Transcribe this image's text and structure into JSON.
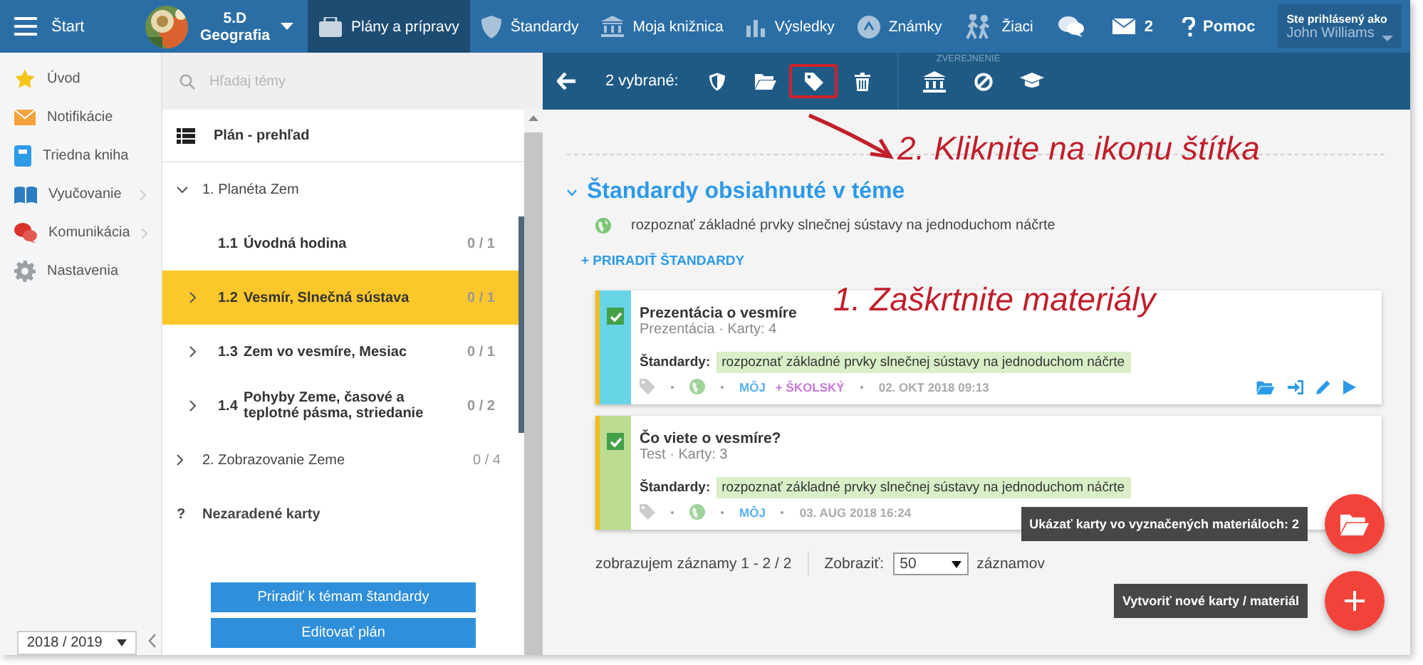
{
  "nav": {
    "menu_label": "Štart",
    "class": {
      "name": "5.D",
      "subject": "Geografia"
    },
    "tabs": [
      {
        "label": "Plány a prípravy",
        "selected": true
      },
      {
        "label": "Štandardy",
        "selected": false
      },
      {
        "label": "Moja knižnica",
        "selected": false
      },
      {
        "label": "Výsledky",
        "selected": false
      },
      {
        "label": "Známky",
        "selected": false
      },
      {
        "label": "Žiaci",
        "selected": false
      }
    ],
    "mail_count": "2",
    "help": "Pomoc",
    "user": {
      "caption": "Ste prihlásený ako",
      "name": "John Williams"
    }
  },
  "sidebar": {
    "items": [
      {
        "label": "Úvod",
        "has_submenu": false
      },
      {
        "label": "Notifikácie",
        "has_submenu": false
      },
      {
        "label": "Triedna kniha",
        "has_submenu": false
      },
      {
        "label": "Vyučovanie",
        "has_submenu": true
      },
      {
        "label": "Komunikácia",
        "has_submenu": true
      },
      {
        "label": "Nastavenia",
        "has_submenu": false
      }
    ],
    "year": "2018 / 2019"
  },
  "topics": {
    "search_placeholder": "Hľadaj témy",
    "overview": "Plán - prehľad",
    "tree": [
      {
        "label": "1. Planéta Zem",
        "expanded": true,
        "selected": false,
        "children": [
          {
            "number": "1.1",
            "title": "Úvodná hodina",
            "count": "0 / 1",
            "has_children": false,
            "selected": false
          },
          {
            "number": "1.2",
            "title": "Vesmír, Slnečná sústava",
            "count": "0 / 1",
            "has_children": true,
            "selected": true
          },
          {
            "number": "1.3",
            "title": "Zem vo vesmíre, Mesiac",
            "count": "0 / 1",
            "has_children": true,
            "selected": false
          },
          {
            "number": "1.4",
            "title": "Pohyby Zeme, časové a teplotné pásma, striedanie",
            "count": "0 / 2",
            "has_children": true,
            "selected": false
          }
        ]
      },
      {
        "label": "2. Zobrazovanie Zeme",
        "count": "0 / 4",
        "expanded": false,
        "selected": false
      }
    ],
    "unassigned": {
      "mark": "?",
      "label": "Nezaradené karty"
    },
    "buttons": [
      "Priradiť k témam štandardy",
      "Editovať plán"
    ]
  },
  "toolbar": {
    "selection": "2 vybrané:",
    "groups": [
      {
        "buttons": [
          {
            "highlighted": false
          },
          {
            "highlighted": false
          },
          {
            "highlighted": true
          },
          {
            "highlighted": false
          }
        ]
      },
      {
        "label": "ZVEREJNENIE",
        "buttons": [
          {
            "highlighted": false
          },
          {
            "highlighted": false
          },
          {
            "highlighted": false
          }
        ]
      }
    ]
  },
  "annotations": [
    {
      "text": "2. Kliknite na ikonu štítka"
    },
    {
      "text": "1. Zaškrtnite materiály"
    }
  ],
  "standards": {
    "title": "Štandardy obsiahnuté v téme",
    "expanded": true,
    "items": [
      "rozpoznať základné prvky slnečnej sústavy na jednoduchom náčrte"
    ],
    "assign_link": "+ PRIRADIŤ ŠTANDARDY"
  },
  "cards": [
    {
      "title": "Prezentácia o vesmíre",
      "meta": "Prezentácia · Karty: 4",
      "checked": true,
      "color": "#67d5e6",
      "standards_label": "Štandardy:",
      "standard": "rozpoznať základné prvky slnečnej sústavy na jednoduchom náčrte",
      "scopes": [
        {
          "label": "MÔJ",
          "kind": "own"
        },
        {
          "label": "+ ŠKOLSKÝ",
          "kind": "school"
        }
      ],
      "date": "02. OKT 2018 09:13",
      "actions_covered": false
    },
    {
      "title": "Čo viete o vesmíre?",
      "meta": "Test · Karty: 3",
      "checked": true,
      "color": "#bcdc90",
      "standards_label": "Štandardy:",
      "standard": "rozpoznať základné prvky slnečnej sústavy na jednoduchom náčrte",
      "scopes": [
        {
          "label": "MÔJ",
          "kind": "own"
        }
      ],
      "date": "03. AUG 2018 16:24",
      "actions_covered": true
    }
  ],
  "pagination": {
    "summary": "zobrazujem záznamy 1 - 2 / 2",
    "show_label": "Zobraziť:",
    "page_size": "50",
    "unit": "záznamov"
  },
  "fabs": [
    {
      "tooltip": "Ukázať karty vo vyznačených materiáloch: 2"
    },
    {
      "tooltip": "Vytvoriť nové karty / materiál"
    }
  ]
}
